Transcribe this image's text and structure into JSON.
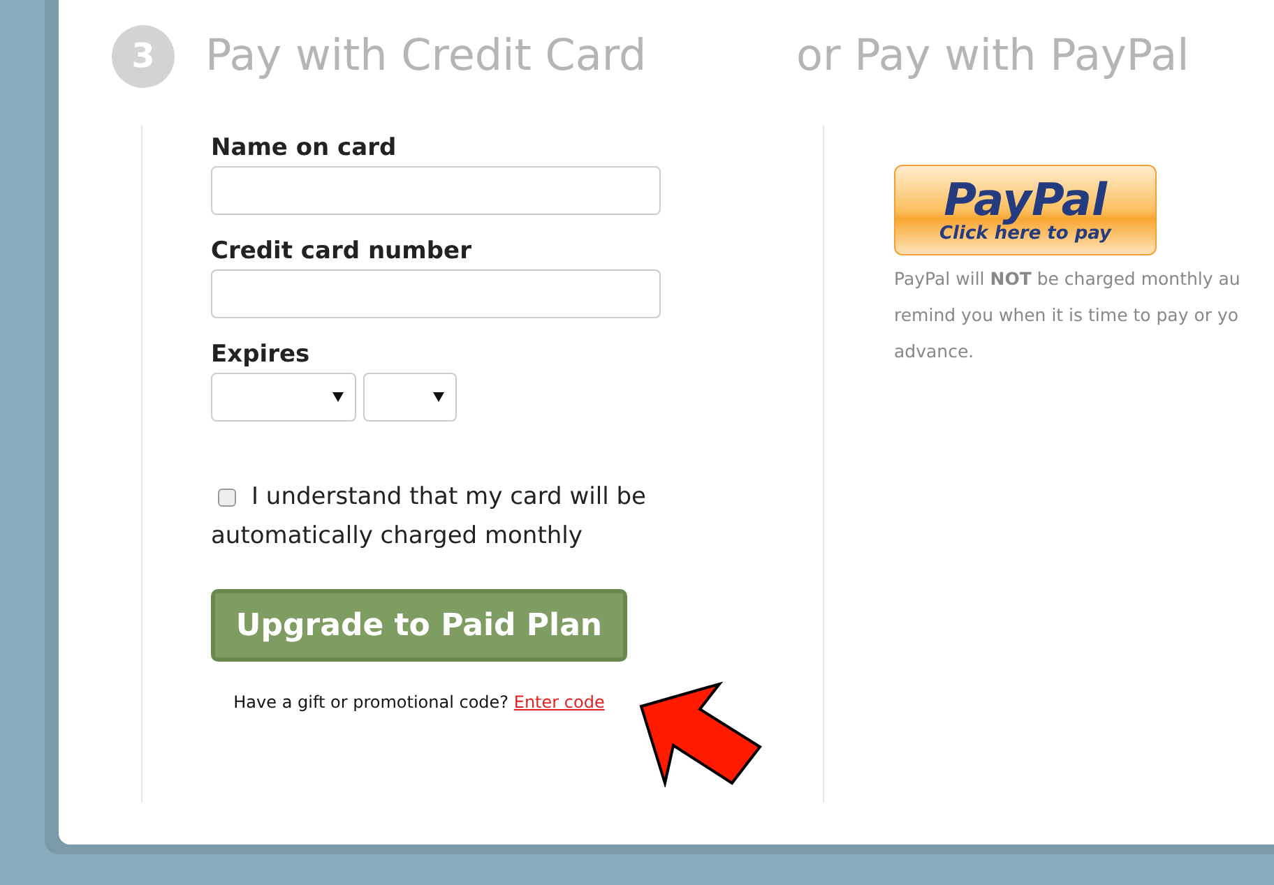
{
  "step": {
    "number": "3",
    "title": "Pay with Credit Card"
  },
  "paypal_heading": "or Pay with PayPal",
  "form": {
    "fields": [
      {
        "label": "Name on card",
        "kind": "text"
      },
      {
        "label": "Credit card number",
        "kind": "text"
      },
      {
        "label": "Expires",
        "kind": "selects"
      }
    ],
    "agree": {
      "label_lines": [
        "I understand that my card will be",
        "automatically charged monthly"
      ],
      "checked": false
    },
    "submit": "Upgrade to Paid Plan",
    "promo": {
      "text": "Have a gift or promotional code?",
      "link": "Enter code"
    }
  },
  "paypal": {
    "logo": "PayPal",
    "caption": "Click here to pay",
    "note_lines": [
      "PayPal will **NOT** be charged monthly au",
      "remind you when it is time to pay or yo",
      "advance."
    ]
  }
}
